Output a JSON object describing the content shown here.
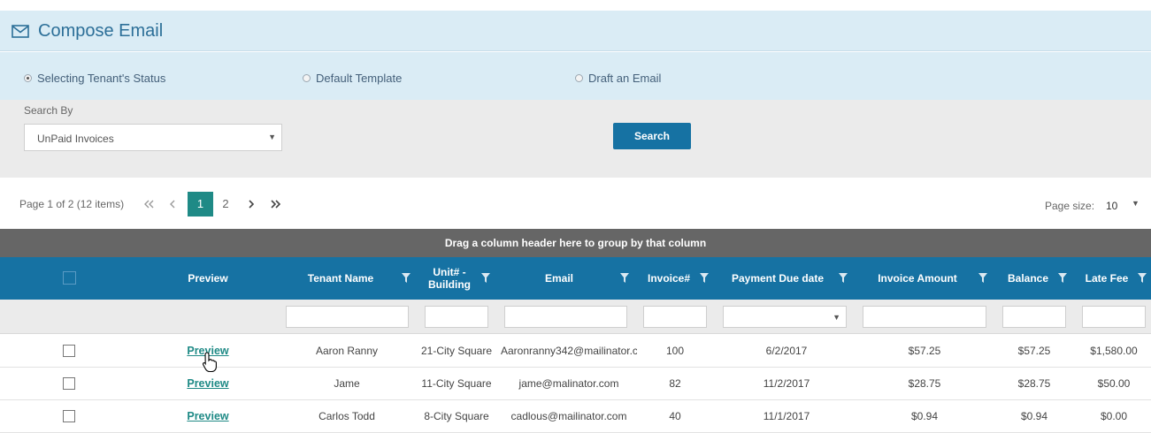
{
  "header": {
    "title": "Compose Email",
    "icon": "envelope-icon"
  },
  "modes": [
    {
      "label": "Selecting Tenant's Status",
      "selected": true
    },
    {
      "label": "Default Template",
      "selected": false
    },
    {
      "label": "Draft an Email",
      "selected": false
    }
  ],
  "search": {
    "label": "Search By",
    "selected_value": "UnPaid Invoices",
    "button_label": "Search"
  },
  "pager": {
    "info": "Page 1 of 2 (12 items)",
    "pages": [
      "1",
      "2"
    ],
    "current_page": "1",
    "page_size_label": "Page size:",
    "page_size_value": "10"
  },
  "grid": {
    "group_hint": "Drag a column header here to group by that column",
    "columns": {
      "preview": "Preview",
      "tenant": "Tenant Name",
      "unit_line1": "Unit# -",
      "unit_line2": "Building",
      "email": "Email",
      "invoice": "Invoice#",
      "due": "Payment Due date",
      "amount": "Invoice Amount",
      "balance": "Balance",
      "late_fee": "Late Fee"
    },
    "rows": [
      {
        "preview": "Preview",
        "tenant": "Aaron Ranny",
        "unit": "21-City Square",
        "email": "Aaronranny342@mailinator.c",
        "invoice": "100",
        "due": "6/2/2017",
        "amount": "$57.25",
        "balance": "$57.25",
        "late_fee": "$1,580.00"
      },
      {
        "preview": "Preview",
        "tenant": "Jame",
        "unit": "11-City Square",
        "email": "jame@malinator.com",
        "invoice": "82",
        "due": "11/2/2017",
        "amount": "$28.75",
        "balance": "$28.75",
        "late_fee": "$50.00"
      },
      {
        "preview": "Preview",
        "tenant": "Carlos Todd",
        "unit": "8-City Square",
        "email": "cadlous@mailinator.com",
        "invoice": "40",
        "due": "11/1/2017",
        "amount": "$0.94",
        "balance": "$0.94",
        "late_fee": "$0.00"
      }
    ]
  },
  "colors": {
    "header_blue": "#1672a3",
    "accent_teal": "#1f8a86",
    "panel_blue": "#daecf5"
  }
}
